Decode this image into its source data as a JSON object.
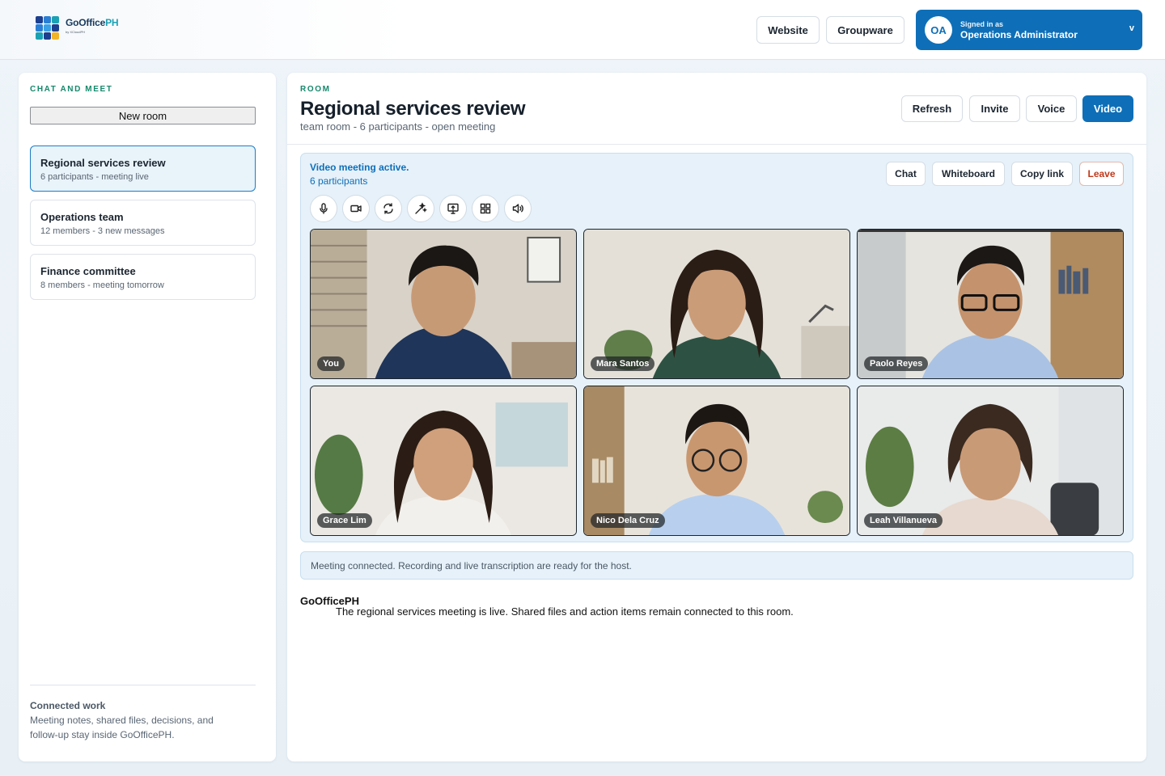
{
  "header": {
    "logo_title": "GoOffice",
    "logo_title_suffix": "PH",
    "logo_sub": "by XCloudPH",
    "website_label": "Website",
    "groupware_label": "Groupware",
    "user_initials": "OA",
    "signed_in_label": "Signed in as",
    "user_name": "Operations Administrator",
    "user_chevron": "v"
  },
  "sidebar": {
    "kicker": "CHAT AND MEET",
    "new_room_label": "New room",
    "rooms": [
      {
        "name": "Regional services review",
        "meta": "6 participants - meeting live",
        "active": true
      },
      {
        "name": "Operations team",
        "meta": "12 members - 3 new messages",
        "active": false
      },
      {
        "name": "Finance committee",
        "meta": "8 members - meeting tomorrow",
        "active": false
      }
    ],
    "footer_title": "Connected work",
    "footer_text": "Meeting notes, shared files, decisions, and follow-up stay inside GoOfficePH."
  },
  "room": {
    "kicker": "ROOM",
    "title": "Regional services review",
    "subtitle": "team room - 6 participants - open meeting",
    "actions": {
      "refresh": "Refresh",
      "invite": "Invite",
      "voice": "Voice",
      "video": "Video"
    }
  },
  "meeting": {
    "status": "Video meeting active.",
    "count": "6 participants",
    "buttons": {
      "chat": "Chat",
      "whiteboard": "Whiteboard",
      "copy_link": "Copy link",
      "leave": "Leave"
    },
    "controls": [
      "microphone-icon",
      "camera-icon",
      "switch-camera-icon",
      "effects-icon",
      "share-screen-icon",
      "grid-layout-icon",
      "speaker-icon"
    ],
    "participants": [
      {
        "name": "You"
      },
      {
        "name": "Mara Santos"
      },
      {
        "name": "Paolo Reyes"
      },
      {
        "name": "Grace Lim"
      },
      {
        "name": "Nico Dela Cruz"
      },
      {
        "name": "Leah Villanueva"
      }
    ],
    "notice": "Meeting connected. Recording and live transcription are ready for the host."
  },
  "messages": [
    {
      "author": "GoOfficePH",
      "text": "The regional services meeting is live. Shared files and action items remain connected to this room."
    }
  ],
  "colors": {
    "accent": "#0e6fb8",
    "kicker": "#15896b",
    "leave": "#c0391b",
    "panel_tint": "#e6f1f9"
  }
}
